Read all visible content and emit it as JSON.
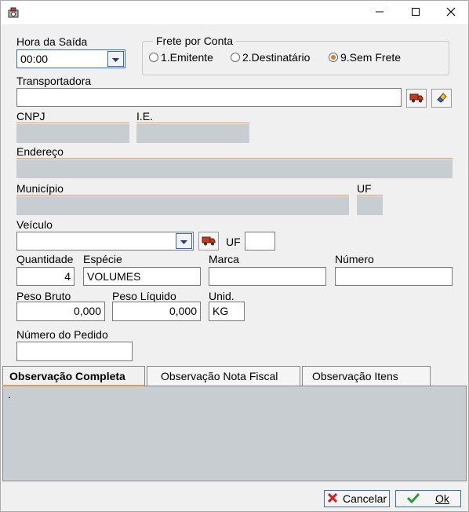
{
  "window": {
    "minimize_glyph": "—",
    "maximize_glyph": "☐",
    "close_glyph": "✕"
  },
  "hora": {
    "label": "Hora da Saída",
    "value": "00:00"
  },
  "frete": {
    "title": "Frete por Conta",
    "options": [
      {
        "label": "1.Emitente",
        "selected": false
      },
      {
        "label": "2.Destinatário",
        "selected": false
      },
      {
        "label": "9.Sem Frete",
        "selected": true
      }
    ]
  },
  "transportadora": {
    "label": "Transportadora",
    "value": ""
  },
  "cnpj": {
    "label": "CNPJ",
    "value": ""
  },
  "ie": {
    "label": "I.E.",
    "value": ""
  },
  "endereco": {
    "label": "Endereço",
    "value": ""
  },
  "municipio": {
    "label": "Município",
    "value": ""
  },
  "uf_transp": {
    "label": "UF",
    "value": ""
  },
  "veiculo": {
    "label": "Veículo",
    "value": "",
    "uf_label": "UF",
    "uf_value": ""
  },
  "quantidade": {
    "label": "Quantidade",
    "value": "4"
  },
  "especie": {
    "label": "Espécie",
    "value": "VOLUMES"
  },
  "marca": {
    "label": "Marca",
    "value": ""
  },
  "numero": {
    "label": "Número",
    "value": ""
  },
  "peso_bruto": {
    "label": "Peso Bruto",
    "value": "0,000"
  },
  "peso_liquido": {
    "label": "Peso Líquido",
    "value": "0,000"
  },
  "unid": {
    "label": "Unid.",
    "value": "KG"
  },
  "numero_pedido": {
    "label": "Número do Pedido",
    "value": ""
  },
  "tabs": [
    {
      "label": "Observação Completa",
      "active": true
    },
    {
      "label": "Observação Nota Fiscal",
      "active": false
    },
    {
      "label": "Observação Itens",
      "active": false
    }
  ],
  "observacao": {
    "text": "."
  },
  "buttons": {
    "cancel": "Cancelar",
    "ok": "Ok"
  },
  "colors": {
    "readonly_fill": "#c8cdd2",
    "underline_accent": "#e39a5a",
    "radio_selected": "#e07a2c",
    "cancel_icon": "#d42020",
    "ok_icon": "#2a9a3a"
  },
  "icons": [
    "app-icon",
    "minimize-icon",
    "maximize-icon",
    "close-icon",
    "dropdown-arrow-icon",
    "truck-icon",
    "eraser-icon",
    "cancel-x-icon",
    "ok-check-icon"
  ]
}
